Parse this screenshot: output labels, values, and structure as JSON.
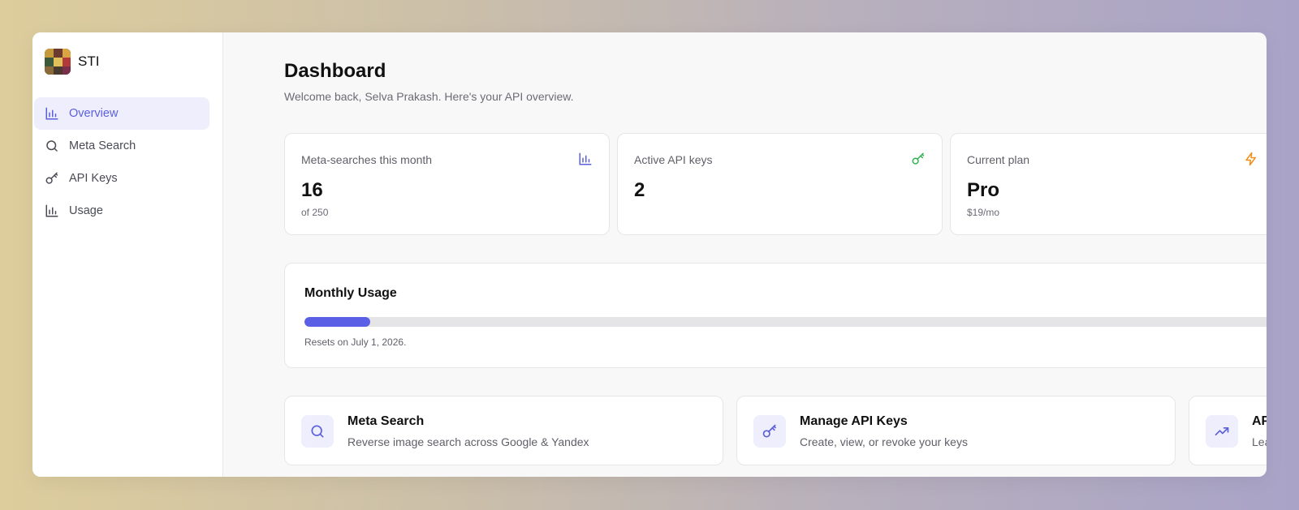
{
  "brand": {
    "name": "STI"
  },
  "sidebar": {
    "items": [
      {
        "label": "Overview",
        "icon": "bar-chart-icon",
        "active": true
      },
      {
        "label": "Meta Search",
        "icon": "search-icon"
      },
      {
        "label": "API Keys",
        "icon": "key-icon"
      },
      {
        "label": "Usage",
        "icon": "bar-chart-icon"
      }
    ]
  },
  "header": {
    "title": "Dashboard",
    "subtitle": "Welcome back, Selva Prakash. Here's your API overview."
  },
  "stats": [
    {
      "label": "Meta-searches this month",
      "value": "16",
      "sub": "of 250",
      "icon": "bar-chart-icon",
      "color": "#5b5fdc"
    },
    {
      "label": "Active API keys",
      "value": "2",
      "sub": "",
      "icon": "key-icon",
      "color": "#2fb24f"
    },
    {
      "label": "Current plan",
      "value": "Pro",
      "sub": "$19/mo",
      "icon": "lightning-icon",
      "color": "#f0901a"
    }
  ],
  "usage": {
    "title": "Monthly Usage",
    "used": 16,
    "limit": 250,
    "note": "Resets on July 1, 2026."
  },
  "actions": [
    {
      "title": "Meta Search",
      "desc": "Reverse image search across Google & Yandex",
      "icon": "search-icon"
    },
    {
      "title": "Manage API Keys",
      "desc": "Create, view, or revoke your keys",
      "icon": "key-icon"
    },
    {
      "title": "API Docs",
      "desc": "Learn how",
      "icon": "trending-up-icon"
    }
  ],
  "colors": {
    "accent": "#5b5fe6",
    "accent_bg": "#eeeefc"
  }
}
